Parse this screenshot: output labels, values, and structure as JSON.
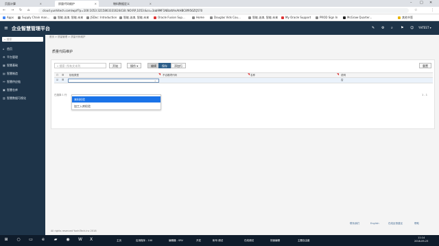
{
  "browser": {
    "tabs": [
      {
        "label": "页面计算",
        "active": false
      },
      {
        "label": "质量代码维护",
        "active": true
      },
      {
        "label": "物料数据定义",
        "active": false
      }
    ],
    "url": "cloud.yunhitech.com/wp/f?p=100:1053:3215863331624418::NO:RP,1053:&cs=3ab9MF1NBzdtAnAtHBC8f956ZQ570",
    "bookmarks": [
      "Apps",
      "Supply Chain man...",
      "智能.油漆, 智能.未来",
      "JSDoc: Introduction",
      "智能.油漆, 智能.未来",
      "Oracle Fusion Sup...",
      "Home",
      "Douglas Vids Cou...",
      "智能.油漆, 智能.未来",
      "My Oracle Support",
      "PROD Sign In",
      "McGraw Quarter...",
      "其他书签"
    ]
  },
  "app": {
    "title": "企业智慧管理平台",
    "user": "YHTEST ▾"
  },
  "sidebar": {
    "search_placeholder": "搜索",
    "items": [
      {
        "label": "首页"
      },
      {
        "label": "平台管理"
      },
      {
        "label": "智慧基础"
      },
      {
        "label": "智慧制造"
      },
      {
        "label": "智慧供应链"
      },
      {
        "label": "智慧仓库"
      },
      {
        "label": "智慧数据可视化"
      }
    ]
  },
  "main": {
    "breadcrumb": "首页 > 质量管理 > 质量代码维护",
    "page_title": "质量代码维护",
    "search_placeholder": "搜索: 所有文本列",
    "buttons": {
      "go": "开始",
      "actions": "操作 ▾",
      "edit": "编辑",
      "save": "保存",
      "add_row": "添加行",
      "reset": "重置"
    },
    "columns": [
      "检验类型",
      "不合格项代码",
      "名称",
      "说明"
    ],
    "row_values": {
      "col4": "否"
    },
    "pagination_left": "已选择 1 行",
    "pagination_right": "1 - 1",
    "dropdown_options": [
      "来料检验",
      "加工入库检验"
    ]
  },
  "footer": {
    "copyright": "All rights reserved YunhiTech.inc 2018",
    "links": [
      "联系我们",
      "English",
      "在线反馈建议",
      "帮助"
    ]
  },
  "taskbar": {
    "apps": [
      "主页",
      "应用程序 - 100",
      "编辑器 - SRV",
      "开发",
      "帐号.调试",
      "在线调试",
      "快速编辑",
      "主题自由度"
    ],
    "time": "11:14",
    "date": "2018-09-23"
  },
  "colors": {
    "header_bg": "#1e3449",
    "primary": "#2e5f8a",
    "dropdown_selected": "#1a73e8"
  }
}
